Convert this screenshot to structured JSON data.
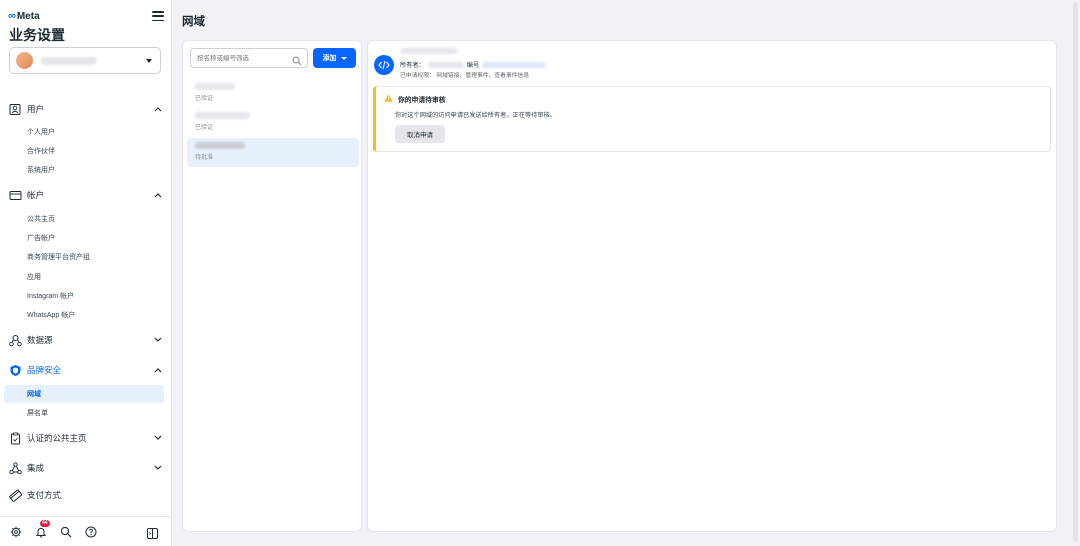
{
  "brand": {
    "logo_text": "Meta"
  },
  "sidebar": {
    "title": "业务设置",
    "account_select": {
      "value": ""
    },
    "sections": [
      {
        "id": "users",
        "label": "用户",
        "icon": "user-group-icon",
        "expanded": true,
        "items": [
          "个人用户",
          "合作伙伴",
          "系统用户"
        ]
      },
      {
        "id": "accounts",
        "label": "帐户",
        "icon": "account-box-icon",
        "expanded": true,
        "items": [
          "公共主页",
          "广告帐户",
          "商务管理平台资产组",
          "应用",
          "Instagram 帐户",
          "WhatsApp 帐户"
        ]
      },
      {
        "id": "data-sources",
        "label": "数据源",
        "icon": "data-source-icon",
        "expanded": false,
        "items": []
      },
      {
        "id": "brand-safety",
        "label": "品牌安全",
        "icon": "shield-icon",
        "expanded": true,
        "active": true,
        "items": [
          "网域",
          "屏名单"
        ],
        "active_item": "网域"
      },
      {
        "id": "verified-pages",
        "label": "认证的公共主页",
        "icon": "clipboard-check-icon",
        "expanded": false,
        "items": []
      },
      {
        "id": "integrations",
        "label": "集成",
        "icon": "integrations-icon",
        "expanded": false,
        "items": []
      },
      {
        "id": "payment",
        "label": "支付方式",
        "icon": "credit-card-icon",
        "items": []
      }
    ],
    "footer": {
      "notification_count": "44",
      "icons": [
        "gear-icon",
        "bell-icon",
        "search-icon",
        "help-icon",
        "panel-toggle-icon"
      ]
    }
  },
  "main": {
    "page_title": "网域",
    "search": {
      "placeholder": "按名称或编号筛选"
    },
    "add_button": {
      "label": "添加"
    },
    "domains": [
      {
        "status": "已验证",
        "selected": false
      },
      {
        "status": "已验证",
        "selected": false
      },
      {
        "status": "待批准",
        "selected": true
      }
    ],
    "detail": {
      "owner_label": "所有者：",
      "id_label": "编号",
      "permissions": "已申请权限：  网域链接、管理事件、查看事件信息",
      "alert": {
        "title": "你的申请待审核",
        "body": "你对这个网域的访问申请已发送给所有者，正在等待审核。",
        "cancel_label": "取消申请"
      }
    }
  },
  "colors": {
    "accent": "#0866ff",
    "warning": "#f7b928",
    "selected_bg": "#e7f0fd"
  }
}
